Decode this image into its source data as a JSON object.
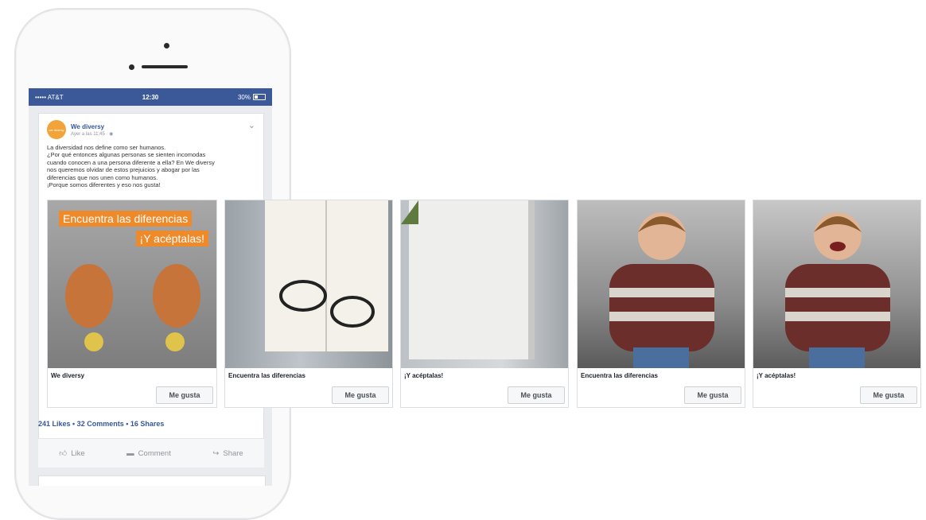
{
  "status_bar": {
    "carrier": "••••• AT&T",
    "time": "12:30",
    "battery": "30%"
  },
  "post": {
    "page_name": "We diversy",
    "avatar_text": "we diversy",
    "meta": "Ayer a las 11:45 · ",
    "text_lines": [
      "La diversidad nos define como ser humanos.",
      "¿Por qué entonces algunas personas se sienten incomodas",
      "cuando conocen a una persona diferente a ella? En We diversy",
      "nos queremos olvidar de estos prejuicios y abogar por las",
      "diferencias que nos unen como humanos.",
      "¡Porque somos diferentes y eso nos gusta!"
    ],
    "stats": "241 Likes • 32 Comments • 16 Shares",
    "actions": {
      "like": "Like",
      "comment": "Comment",
      "share": "Share"
    }
  },
  "cards": [
    {
      "caption": "We diversy",
      "button": "Me gusta",
      "banner_line1": "Encuentra las diferencias",
      "banner_line2": "¡Y acéptalas!"
    },
    {
      "caption": "Encuentra las diferencias",
      "button": "Me gusta"
    },
    {
      "caption": "¡Y acéptalas!",
      "button": "Me gusta"
    },
    {
      "caption": "Encuentra las diferencias",
      "button": "Me gusta"
    },
    {
      "caption": "¡Y acéptalas!",
      "button": "Me gusta"
    }
  ],
  "colors": {
    "facebook_blue": "#3b5998",
    "link_blue": "#365899",
    "banner_orange": "#ee8a2a"
  },
  "icons": [
    "thumbs-up-icon",
    "comment-icon",
    "share-icon",
    "chevron-down-icon",
    "globe-icon",
    "battery-icon"
  ]
}
